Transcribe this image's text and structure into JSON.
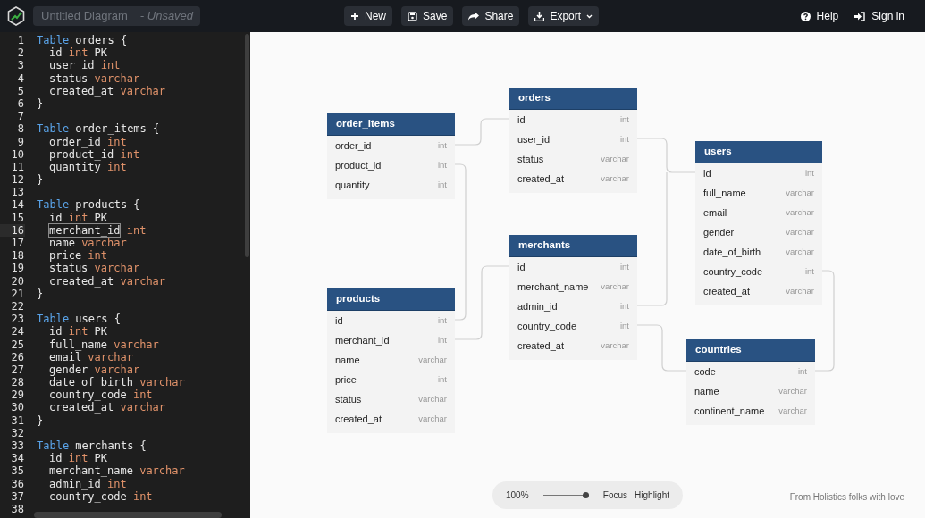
{
  "header": {
    "diagram_name": "Untitled Diagram",
    "save_state": "- Unsaved",
    "buttons": [
      {
        "label": "New"
      },
      {
        "label": "Save"
      },
      {
        "label": "Share"
      },
      {
        "label": "Export",
        "dropdown": true
      }
    ],
    "right_buttons": [
      {
        "label": "Help"
      },
      {
        "label": "Sign in"
      }
    ]
  },
  "editor": {
    "lines": [
      {
        "number": "1",
        "active": false,
        "indented": false,
        "segments": [
          {
            "kind": "keyword",
            "text": "Table"
          },
          {
            "kind": "ident",
            "text": " orders {"
          }
        ]
      },
      {
        "number": "2",
        "active": false,
        "indented": true,
        "segments": [
          {
            "kind": "ident",
            "text": "id "
          },
          {
            "kind": "type",
            "text": "int"
          },
          {
            "kind": "ident",
            "text": " PK"
          }
        ]
      },
      {
        "number": "3",
        "active": false,
        "indented": true,
        "segments": [
          {
            "kind": "ident",
            "text": "user_id "
          },
          {
            "kind": "type",
            "text": "int"
          }
        ]
      },
      {
        "number": "4",
        "active": false,
        "indented": true,
        "segments": [
          {
            "kind": "ident",
            "text": "status "
          },
          {
            "kind": "type",
            "text": "varchar"
          }
        ]
      },
      {
        "number": "5",
        "active": false,
        "indented": true,
        "segments": [
          {
            "kind": "ident",
            "text": "created_at "
          },
          {
            "kind": "type",
            "text": "varchar"
          }
        ]
      },
      {
        "number": "6",
        "active": false,
        "indented": false,
        "segments": [
          {
            "kind": "ident",
            "text": "}"
          }
        ]
      },
      {
        "number": "7",
        "active": false
      },
      {
        "number": "8",
        "active": false,
        "indented": false,
        "segments": [
          {
            "kind": "keyword",
            "text": "Table"
          },
          {
            "kind": "ident",
            "text": " order_items {"
          }
        ]
      },
      {
        "number": "9",
        "active": false,
        "indented": true,
        "segments": [
          {
            "kind": "ident",
            "text": "order_id "
          },
          {
            "kind": "type",
            "text": "int"
          }
        ]
      },
      {
        "number": "10",
        "active": false,
        "indented": true,
        "segments": [
          {
            "kind": "ident",
            "text": "product_id "
          },
          {
            "kind": "type",
            "text": "int"
          }
        ]
      },
      {
        "number": "11",
        "active": false,
        "indented": true,
        "segments": [
          {
            "kind": "ident",
            "text": "quantity "
          },
          {
            "kind": "type",
            "text": "int"
          }
        ]
      },
      {
        "number": "12",
        "active": false,
        "indented": false,
        "segments": [
          {
            "kind": "ident",
            "text": "}"
          }
        ]
      },
      {
        "number": "13",
        "active": false
      },
      {
        "number": "14",
        "active": false,
        "indented": false,
        "segments": [
          {
            "kind": "keyword",
            "text": "Table"
          },
          {
            "kind": "ident",
            "text": " products {"
          }
        ]
      },
      {
        "number": "15",
        "active": false,
        "indented": true,
        "segments": [
          {
            "kind": "ident",
            "text": "id "
          },
          {
            "kind": "type",
            "text": "int"
          },
          {
            "kind": "ident",
            "text": " PK"
          }
        ]
      },
      {
        "number": "16",
        "active": true,
        "indented": true,
        "segments": [
          {
            "kind": "match",
            "text": "merchant_id"
          },
          {
            "kind": "type",
            "text": " int"
          }
        ]
      },
      {
        "number": "17",
        "active": false,
        "indented": true,
        "segments": [
          {
            "kind": "ident",
            "text": "name "
          },
          {
            "kind": "type",
            "text": "varchar"
          }
        ]
      },
      {
        "number": "18",
        "active": false,
        "indented": true,
        "segments": [
          {
            "kind": "ident",
            "text": "price "
          },
          {
            "kind": "type",
            "text": "int"
          }
        ]
      },
      {
        "number": "19",
        "active": false,
        "indented": true,
        "segments": [
          {
            "kind": "ident",
            "text": "status "
          },
          {
            "kind": "type",
            "text": "varchar"
          }
        ]
      },
      {
        "number": "20",
        "active": false,
        "indented": true,
        "segments": [
          {
            "kind": "ident",
            "text": "created_at "
          },
          {
            "kind": "type",
            "text": "varchar"
          }
        ]
      },
      {
        "number": "21",
        "active": false,
        "indented": false,
        "segments": [
          {
            "kind": "ident",
            "text": "}"
          }
        ]
      },
      {
        "number": "22",
        "active": false
      },
      {
        "number": "23",
        "active": false,
        "indented": false,
        "segments": [
          {
            "kind": "keyword",
            "text": "Table"
          },
          {
            "kind": "ident",
            "text": " users {"
          }
        ]
      },
      {
        "number": "24",
        "active": false,
        "indented": true,
        "segments": [
          {
            "kind": "ident",
            "text": "id "
          },
          {
            "kind": "type",
            "text": "int"
          },
          {
            "kind": "ident",
            "text": " PK"
          }
        ]
      },
      {
        "number": "25",
        "active": false,
        "indented": true,
        "segments": [
          {
            "kind": "ident",
            "text": "full_name "
          },
          {
            "kind": "type",
            "text": "varchar"
          }
        ]
      },
      {
        "number": "26",
        "active": false,
        "indented": true,
        "segments": [
          {
            "kind": "ident",
            "text": "email "
          },
          {
            "kind": "type",
            "text": "varchar"
          }
        ]
      },
      {
        "number": "27",
        "active": false,
        "indented": true,
        "segments": [
          {
            "kind": "ident",
            "text": "gender "
          },
          {
            "kind": "type",
            "text": "varchar"
          }
        ]
      },
      {
        "number": "28",
        "active": false,
        "indented": true,
        "segments": [
          {
            "kind": "ident",
            "text": "date_of_birth "
          },
          {
            "kind": "type",
            "text": "varchar"
          }
        ]
      },
      {
        "number": "29",
        "active": false,
        "indented": true,
        "segments": [
          {
            "kind": "ident",
            "text": "country_code "
          },
          {
            "kind": "type",
            "text": "int"
          }
        ]
      },
      {
        "number": "30",
        "active": false,
        "indented": true,
        "segments": [
          {
            "kind": "ident",
            "text": "created_at "
          },
          {
            "kind": "type",
            "text": "varchar"
          }
        ]
      },
      {
        "number": "31",
        "active": false,
        "indented": false,
        "segments": [
          {
            "kind": "ident",
            "text": "}"
          }
        ]
      },
      {
        "number": "32",
        "active": false
      },
      {
        "number": "33",
        "active": false,
        "indented": false,
        "segments": [
          {
            "kind": "keyword",
            "text": "Table"
          },
          {
            "kind": "ident",
            "text": " merchants {"
          }
        ]
      },
      {
        "number": "34",
        "active": false,
        "indented": true,
        "segments": [
          {
            "kind": "ident",
            "text": "id "
          },
          {
            "kind": "type",
            "text": "int"
          },
          {
            "kind": "ident",
            "text": " PK"
          }
        ]
      },
      {
        "number": "35",
        "active": false,
        "indented": true,
        "segments": [
          {
            "kind": "ident",
            "text": "merchant_name "
          },
          {
            "kind": "type",
            "text": "varchar"
          }
        ]
      },
      {
        "number": "36",
        "active": false,
        "indented": true,
        "segments": [
          {
            "kind": "ident",
            "text": "admin_id "
          },
          {
            "kind": "type",
            "text": "int"
          }
        ]
      },
      {
        "number": "37",
        "active": false,
        "indented": true,
        "segments": [
          {
            "kind": "ident",
            "text": "country_code "
          },
          {
            "kind": "type",
            "text": "int"
          }
        ]
      },
      {
        "number": "38",
        "active": false
      }
    ]
  },
  "tables": [
    {
      "name": "orders",
      "fields": [
        {
          "name": "id",
          "type": "int"
        },
        {
          "name": "user_id",
          "type": "int"
        },
        {
          "name": "status",
          "type": "varchar"
        },
        {
          "name": "created_at",
          "type": "varchar"
        }
      ]
    },
    {
      "name": "order_items",
      "fields": [
        {
          "name": "order_id",
          "type": "int"
        },
        {
          "name": "product_id",
          "type": "int"
        },
        {
          "name": "quantity",
          "type": "int"
        }
      ]
    },
    {
      "name": "users",
      "fields": [
        {
          "name": "id",
          "type": "int"
        },
        {
          "name": "full_name",
          "type": "varchar"
        },
        {
          "name": "email",
          "type": "varchar"
        },
        {
          "name": "gender",
          "type": "varchar"
        },
        {
          "name": "date_of_birth",
          "type": "varchar"
        },
        {
          "name": "country_code",
          "type": "int"
        },
        {
          "name": "created_at",
          "type": "varchar"
        }
      ]
    },
    {
      "name": "merchants",
      "fields": [
        {
          "name": "id",
          "type": "int"
        },
        {
          "name": "merchant_name",
          "type": "varchar"
        },
        {
          "name": "admin_id",
          "type": "int"
        },
        {
          "name": "country_code",
          "type": "int"
        },
        {
          "name": "created_at",
          "type": "varchar"
        }
      ]
    },
    {
      "name": "products",
      "fields": [
        {
          "name": "id",
          "type": "int"
        },
        {
          "name": "merchant_id",
          "type": "int"
        },
        {
          "name": "name",
          "type": "varchar"
        },
        {
          "name": "price",
          "type": "int"
        },
        {
          "name": "status",
          "type": "varchar"
        },
        {
          "name": "created_at",
          "type": "varchar"
        }
      ]
    },
    {
      "name": "countries",
      "fields": [
        {
          "name": "code",
          "type": "int"
        },
        {
          "name": "name",
          "type": "varchar"
        },
        {
          "name": "continent_name",
          "type": "varchar"
        }
      ]
    }
  ],
  "zoom_bar": {
    "zoom": "100%",
    "level": 1,
    "options": [
      "Focus",
      "Highlight"
    ]
  },
  "credit": "From Holistics folks with love"
}
